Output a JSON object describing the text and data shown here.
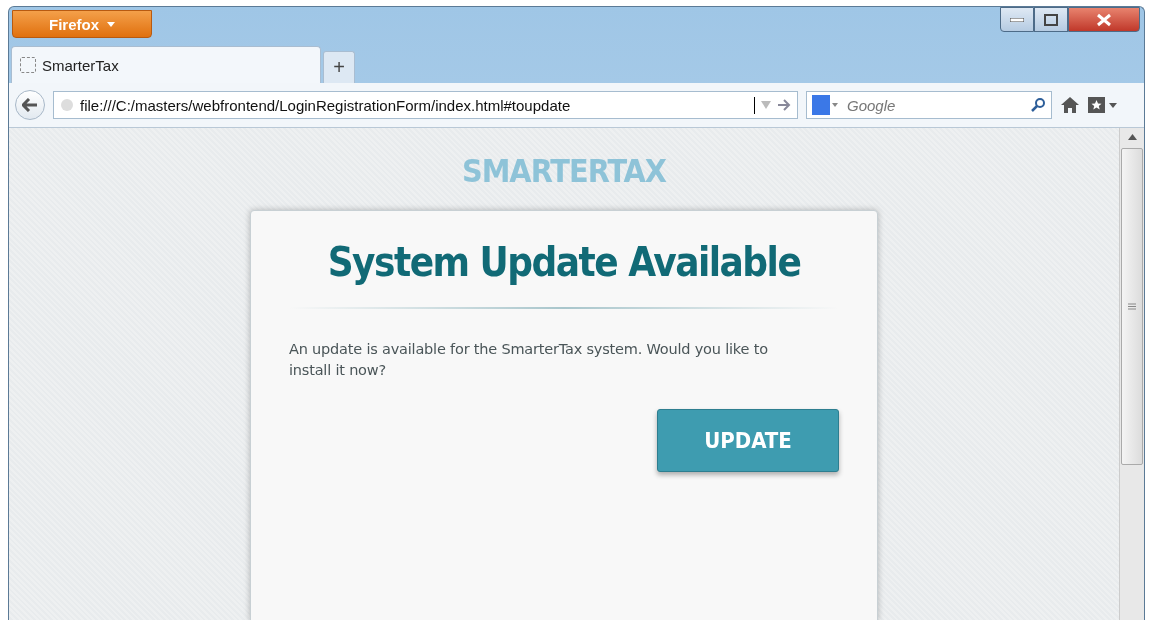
{
  "window": {
    "app_button": "Firefox"
  },
  "tabs": [
    {
      "label": "SmarterTax",
      "selected": true
    }
  ],
  "new_tab": "+",
  "address_bar": {
    "value": "file:///C:/masters/webfrontend/LoginRegistrationForm/index.html#toupdate"
  },
  "search": {
    "placeholder": "Google"
  },
  "page": {
    "brand": "SMARTERTAX",
    "heading": "System Update Available",
    "message": "An update is available for the SmarterTax system. Would you like to install it now?",
    "button": "UPDATE"
  }
}
